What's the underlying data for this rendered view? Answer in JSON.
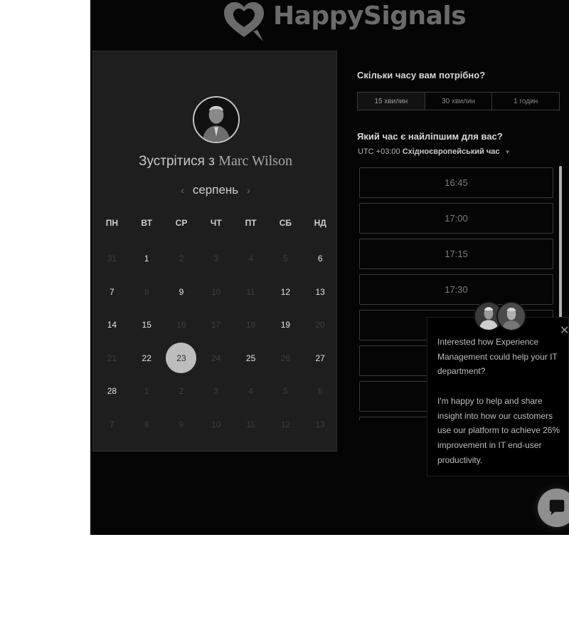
{
  "brand": {
    "name": "HappySignals",
    "icon": "heart-chat-logo"
  },
  "calendar": {
    "meet_prefix": "Зустрітися з",
    "host_name": "Marc Wilson",
    "month": "серпень",
    "prev_icon": "chevron-left-icon",
    "next_icon": "chevron-right-icon",
    "weekdays": [
      "ПН",
      "ВТ",
      "СР",
      "ЧТ",
      "ПТ",
      "СБ",
      "НД"
    ],
    "weeks": [
      [
        {
          "d": "31",
          "a": false
        },
        {
          "d": "1",
          "a": true
        },
        {
          "d": "2",
          "a": false
        },
        {
          "d": "3",
          "a": false
        },
        {
          "d": "4",
          "a": false
        },
        {
          "d": "5",
          "a": false
        },
        {
          "d": "6",
          "a": true
        }
      ],
      [
        {
          "d": "7",
          "a": true
        },
        {
          "d": "8",
          "a": false
        },
        {
          "d": "9",
          "a": true
        },
        {
          "d": "10",
          "a": false
        },
        {
          "d": "11",
          "a": false
        },
        {
          "d": "12",
          "a": true
        },
        {
          "d": "13",
          "a": true
        }
      ],
      [
        {
          "d": "14",
          "a": true
        },
        {
          "d": "15",
          "a": true
        },
        {
          "d": "16",
          "a": false
        },
        {
          "d": "17",
          "a": false
        },
        {
          "d": "18",
          "a": false
        },
        {
          "d": "19",
          "a": true
        },
        {
          "d": "20",
          "a": false
        }
      ],
      [
        {
          "d": "21",
          "a": false
        },
        {
          "d": "22",
          "a": true
        },
        {
          "d": "23",
          "a": true,
          "s": true
        },
        {
          "d": "24",
          "a": false
        },
        {
          "d": "25",
          "a": true
        },
        {
          "d": "26",
          "a": false
        },
        {
          "d": "27",
          "a": true
        }
      ],
      [
        {
          "d": "28",
          "a": true
        },
        {
          "d": "1",
          "a": false
        },
        {
          "d": "2",
          "a": false
        },
        {
          "d": "3",
          "a": false
        },
        {
          "d": "4",
          "a": false
        },
        {
          "d": "5",
          "a": false
        },
        {
          "d": "6",
          "a": false
        }
      ],
      [
        {
          "d": "7",
          "a": false
        },
        {
          "d": "8",
          "a": false
        },
        {
          "d": "9",
          "a": false
        },
        {
          "d": "10",
          "a": false
        },
        {
          "d": "11",
          "a": false
        },
        {
          "d": "12",
          "a": false
        },
        {
          "d": "13",
          "a": false
        }
      ]
    ]
  },
  "booking": {
    "duration_question": "Скільки часу вам потрібно?",
    "durations": [
      "15 хвилин",
      "30 хвилин",
      "1 годин"
    ],
    "selected_duration_index": 0,
    "time_question": "Який час є найліпшим для вас?",
    "tz_offset": "UTC +03:00",
    "tz_name": "Східноєвропейський час",
    "slots": [
      "16:45",
      "17:00",
      "17:15",
      "17:30",
      "",
      "",
      "",
      ""
    ]
  },
  "popup": {
    "text": "Interested how Experience Management could help your IT department?\n\nI'm happy to help and share insight into how our customers use our platform to achieve 26% improvement in IT end-user productivity.",
    "close_icon": "close-icon"
  },
  "chat": {
    "icon": "chat-bubble-icon"
  }
}
